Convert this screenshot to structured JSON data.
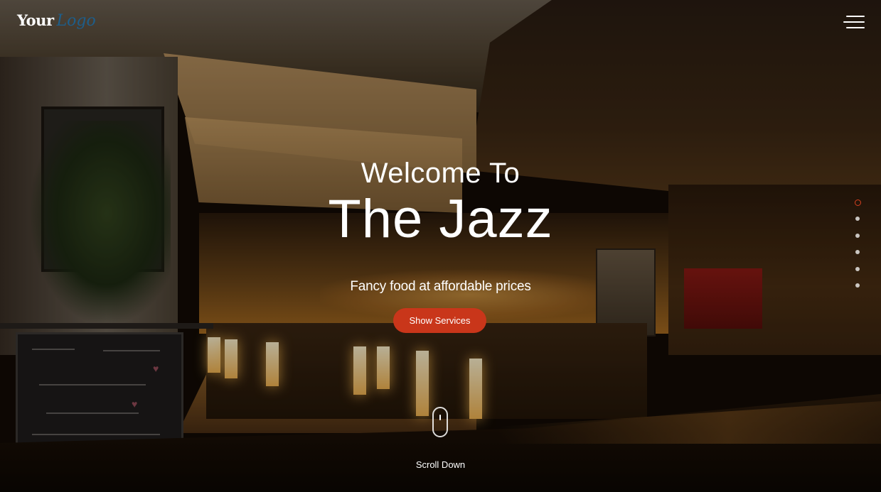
{
  "header": {
    "logo_main": "Your",
    "logo_script": "Logo",
    "menu_icon": "hamburger-menu-icon"
  },
  "hero": {
    "welcome": "Welcome To",
    "title": "The Jazz",
    "tagline": "Fancy food at affordable prices",
    "cta_label": "Show Services",
    "background_image": "dimly lit restaurant bar interior"
  },
  "slider": {
    "dot_count": 6,
    "active_index": 0,
    "active_color": "#d5401f"
  },
  "scroll": {
    "label": "Scroll Down",
    "icon": "mouse-scroll-icon"
  },
  "colors": {
    "accent": "#c9361a",
    "text": "#ffffff",
    "logo_script": "#1e5e8a"
  }
}
